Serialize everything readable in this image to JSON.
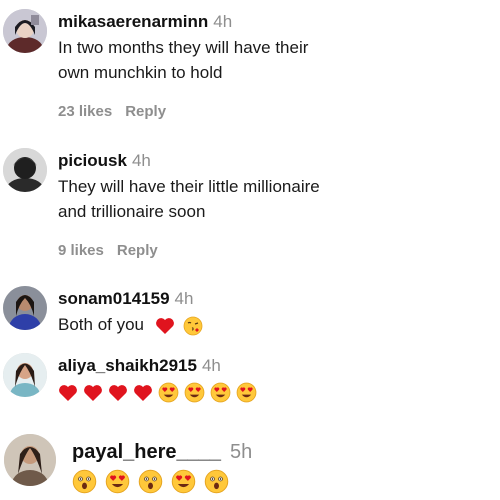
{
  "comments": [
    {
      "username": "mikasaerenarminn",
      "time": "4h",
      "text_lines": [
        "In two months they will have their",
        "own munchkin to hold"
      ],
      "likes": "23 likes",
      "reply": "Reply"
    },
    {
      "username": "piciousk",
      "time": "4h",
      "text_lines": [
        "They will have their little millionaire",
        "and trillionaire soon"
      ],
      "likes": "9 likes",
      "reply": "Reply"
    },
    {
      "username": "sonam014159",
      "time": "4h",
      "text": "Both of you",
      "emojis": [
        "red-heart",
        "kissing-face"
      ]
    },
    {
      "username": "aliya_shaikh2915",
      "time": "4h",
      "emojis": [
        "red-heart",
        "red-heart",
        "red-heart",
        "red-heart",
        "heart-eyes",
        "heart-eyes",
        "heart-eyes",
        "heart-eyes"
      ]
    },
    {
      "username": "payal_here____",
      "time": "5h",
      "emojis": [
        "astonished",
        "heart-eyes",
        "astonished",
        "heart-eyes",
        "astonished"
      ]
    }
  ],
  "colors": {
    "username": "#111111",
    "meta": "#8e8e8e",
    "heart": "#e0141e",
    "emoji_face": "#ffc83a"
  }
}
